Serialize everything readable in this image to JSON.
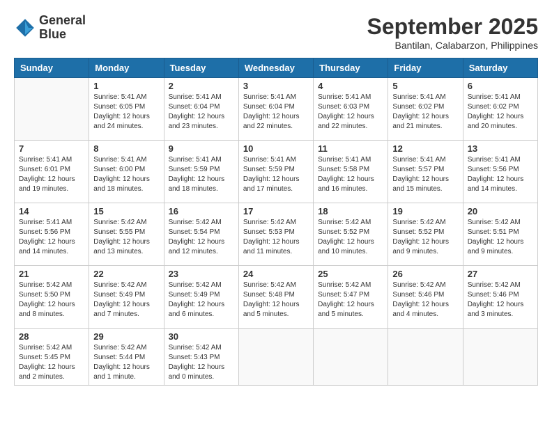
{
  "logo": {
    "line1": "General",
    "line2": "Blue"
  },
  "title": "September 2025",
  "subtitle": "Bantilan, Calabarzon, Philippines",
  "days_of_week": [
    "Sunday",
    "Monday",
    "Tuesday",
    "Wednesday",
    "Thursday",
    "Friday",
    "Saturday"
  ],
  "weeks": [
    [
      {
        "day": "",
        "info": ""
      },
      {
        "day": "1",
        "info": "Sunrise: 5:41 AM\nSunset: 6:05 PM\nDaylight: 12 hours\nand 24 minutes."
      },
      {
        "day": "2",
        "info": "Sunrise: 5:41 AM\nSunset: 6:04 PM\nDaylight: 12 hours\nand 23 minutes."
      },
      {
        "day": "3",
        "info": "Sunrise: 5:41 AM\nSunset: 6:04 PM\nDaylight: 12 hours\nand 22 minutes."
      },
      {
        "day": "4",
        "info": "Sunrise: 5:41 AM\nSunset: 6:03 PM\nDaylight: 12 hours\nand 22 minutes."
      },
      {
        "day": "5",
        "info": "Sunrise: 5:41 AM\nSunset: 6:02 PM\nDaylight: 12 hours\nand 21 minutes."
      },
      {
        "day": "6",
        "info": "Sunrise: 5:41 AM\nSunset: 6:02 PM\nDaylight: 12 hours\nand 20 minutes."
      }
    ],
    [
      {
        "day": "7",
        "info": "Sunrise: 5:41 AM\nSunset: 6:01 PM\nDaylight: 12 hours\nand 19 minutes."
      },
      {
        "day": "8",
        "info": "Sunrise: 5:41 AM\nSunset: 6:00 PM\nDaylight: 12 hours\nand 18 minutes."
      },
      {
        "day": "9",
        "info": "Sunrise: 5:41 AM\nSunset: 5:59 PM\nDaylight: 12 hours\nand 18 minutes."
      },
      {
        "day": "10",
        "info": "Sunrise: 5:41 AM\nSunset: 5:59 PM\nDaylight: 12 hours\nand 17 minutes."
      },
      {
        "day": "11",
        "info": "Sunrise: 5:41 AM\nSunset: 5:58 PM\nDaylight: 12 hours\nand 16 minutes."
      },
      {
        "day": "12",
        "info": "Sunrise: 5:41 AM\nSunset: 5:57 PM\nDaylight: 12 hours\nand 15 minutes."
      },
      {
        "day": "13",
        "info": "Sunrise: 5:41 AM\nSunset: 5:56 PM\nDaylight: 12 hours\nand 14 minutes."
      }
    ],
    [
      {
        "day": "14",
        "info": "Sunrise: 5:41 AM\nSunset: 5:56 PM\nDaylight: 12 hours\nand 14 minutes."
      },
      {
        "day": "15",
        "info": "Sunrise: 5:42 AM\nSunset: 5:55 PM\nDaylight: 12 hours\nand 13 minutes."
      },
      {
        "day": "16",
        "info": "Sunrise: 5:42 AM\nSunset: 5:54 PM\nDaylight: 12 hours\nand 12 minutes."
      },
      {
        "day": "17",
        "info": "Sunrise: 5:42 AM\nSunset: 5:53 PM\nDaylight: 12 hours\nand 11 minutes."
      },
      {
        "day": "18",
        "info": "Sunrise: 5:42 AM\nSunset: 5:52 PM\nDaylight: 12 hours\nand 10 minutes."
      },
      {
        "day": "19",
        "info": "Sunrise: 5:42 AM\nSunset: 5:52 PM\nDaylight: 12 hours\nand 9 minutes."
      },
      {
        "day": "20",
        "info": "Sunrise: 5:42 AM\nSunset: 5:51 PM\nDaylight: 12 hours\nand 9 minutes."
      }
    ],
    [
      {
        "day": "21",
        "info": "Sunrise: 5:42 AM\nSunset: 5:50 PM\nDaylight: 12 hours\nand 8 minutes."
      },
      {
        "day": "22",
        "info": "Sunrise: 5:42 AM\nSunset: 5:49 PM\nDaylight: 12 hours\nand 7 minutes."
      },
      {
        "day": "23",
        "info": "Sunrise: 5:42 AM\nSunset: 5:49 PM\nDaylight: 12 hours\nand 6 minutes."
      },
      {
        "day": "24",
        "info": "Sunrise: 5:42 AM\nSunset: 5:48 PM\nDaylight: 12 hours\nand 5 minutes."
      },
      {
        "day": "25",
        "info": "Sunrise: 5:42 AM\nSunset: 5:47 PM\nDaylight: 12 hours\nand 5 minutes."
      },
      {
        "day": "26",
        "info": "Sunrise: 5:42 AM\nSunset: 5:46 PM\nDaylight: 12 hours\nand 4 minutes."
      },
      {
        "day": "27",
        "info": "Sunrise: 5:42 AM\nSunset: 5:46 PM\nDaylight: 12 hours\nand 3 minutes."
      }
    ],
    [
      {
        "day": "28",
        "info": "Sunrise: 5:42 AM\nSunset: 5:45 PM\nDaylight: 12 hours\nand 2 minutes."
      },
      {
        "day": "29",
        "info": "Sunrise: 5:42 AM\nSunset: 5:44 PM\nDaylight: 12 hours\nand 1 minute."
      },
      {
        "day": "30",
        "info": "Sunrise: 5:42 AM\nSunset: 5:43 PM\nDaylight: 12 hours\nand 0 minutes."
      },
      {
        "day": "",
        "info": ""
      },
      {
        "day": "",
        "info": ""
      },
      {
        "day": "",
        "info": ""
      },
      {
        "day": "",
        "info": ""
      }
    ]
  ]
}
